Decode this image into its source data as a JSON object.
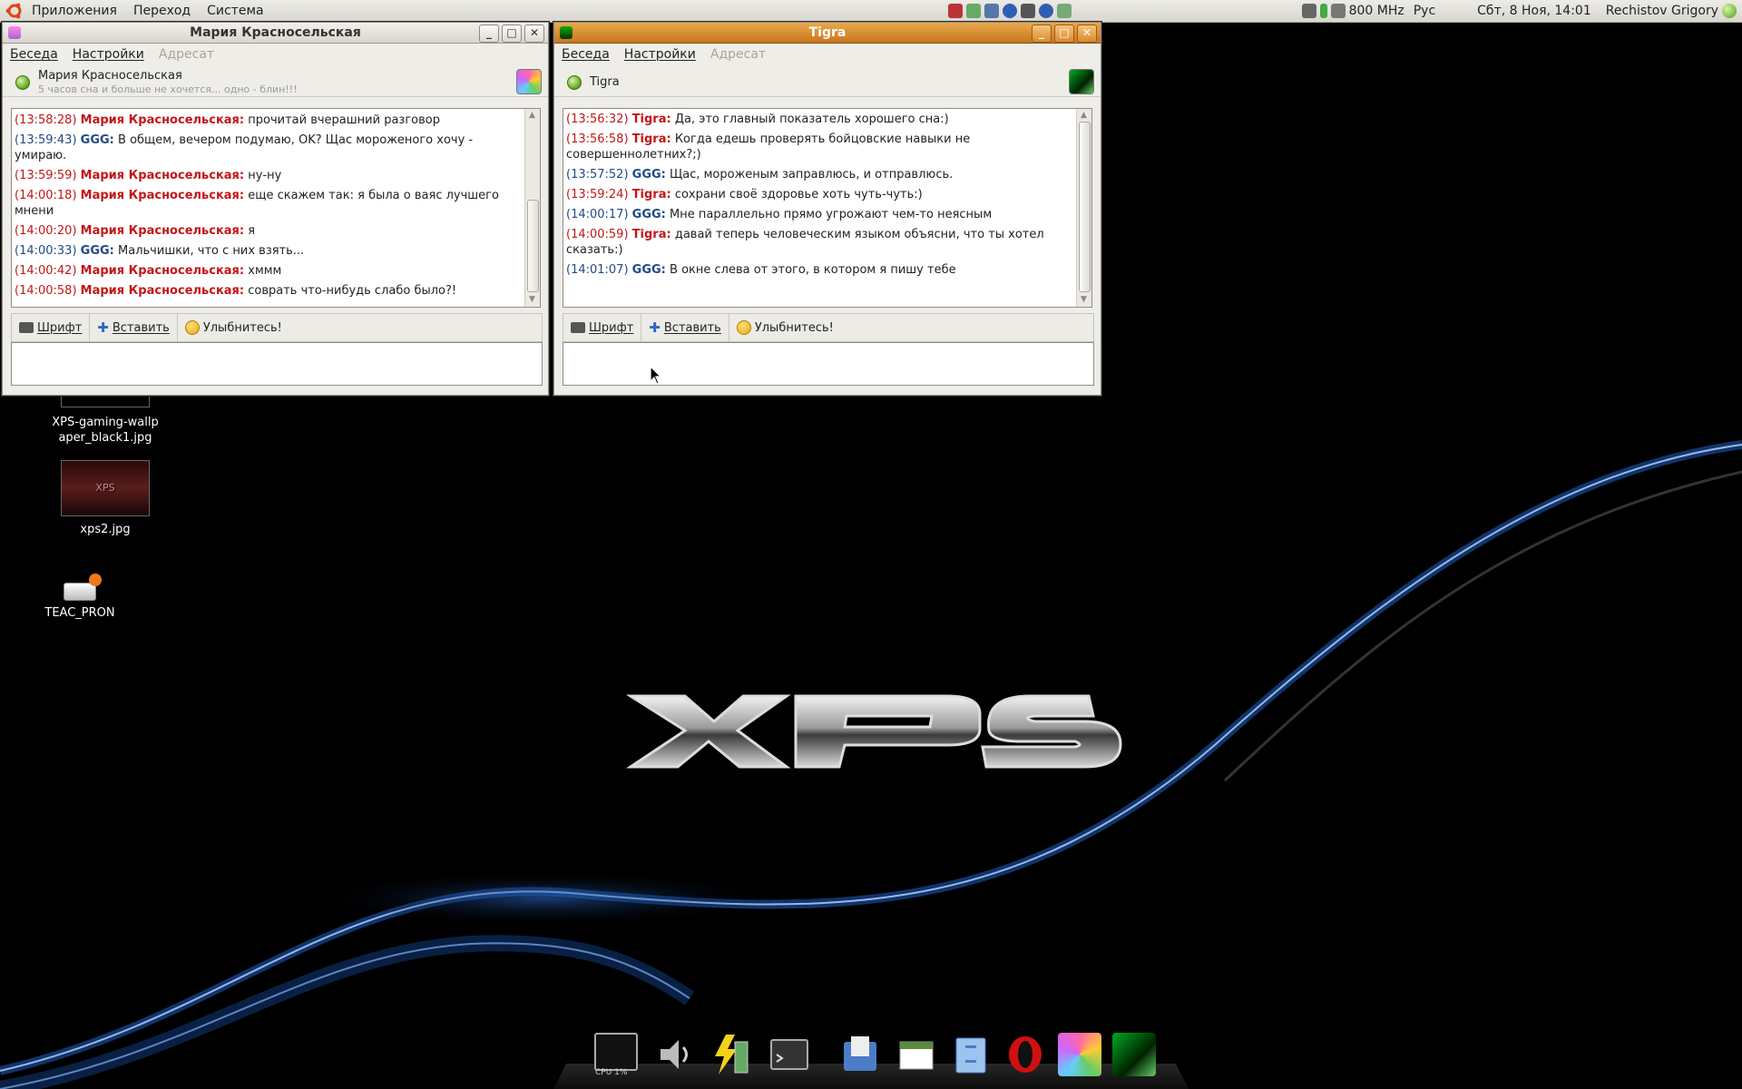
{
  "top_panel": {
    "menus": [
      "Приложения",
      "Переход",
      "Система"
    ],
    "cpu_freq": "800 MHz",
    "keyboard_layout": "Рус",
    "clock": "Сбт, 8 Ноя, 14:01",
    "user": "Rechistov Grigory"
  },
  "windows": {
    "left": {
      "title": "Мария Красносельская",
      "menu": [
        "Беседа",
        "Настройки",
        "Адресат"
      ],
      "contact_name": "Мария Красносельская",
      "contact_status": "5 часов сна и больше не хочется... одно - блин!!!",
      "messages": [
        {
          "time": "(13:58:28)",
          "nick": "Мария Красносельская:",
          "text": "прочитай вчерашний разговор",
          "who": "them"
        },
        {
          "time": "(13:59:43)",
          "nick": "GGG:",
          "text": "В общем, вечером подумаю, OK? Щас мороженого хочу - умираю.",
          "who": "me"
        },
        {
          "time": "(13:59:59)",
          "nick": "Мария Красносельская:",
          "text": "ну-ну",
          "who": "them"
        },
        {
          "time": "(14:00:18)",
          "nick": "Мария Красносельская:",
          "text": "еще скажем так: я была о ваяс лучшего мнени",
          "who": "them"
        },
        {
          "time": "(14:00:20)",
          "nick": "Мария Красносельская:",
          "text": "я",
          "who": "them"
        },
        {
          "time": "(14:00:33)",
          "nick": "GGG:",
          "text": "Мальчишки, что с них взять...",
          "who": "me"
        },
        {
          "time": "(14:00:42)",
          "nick": "Мария Красносельская:",
          "text": "хммм",
          "who": "them"
        },
        {
          "time": "(14:00:58)",
          "nick": "Мария Красносельская:",
          "text": "соврать что-нибудь слабо было?!",
          "who": "them"
        }
      ],
      "toolbar": {
        "font": "Шрифт",
        "insert": "Вставить",
        "smile": "Улыбнитесь!"
      }
    },
    "right": {
      "title": "Tigra",
      "menu": [
        "Беседа",
        "Настройки",
        "Адресат"
      ],
      "contact_name": "Tigra",
      "messages": [
        {
          "time": "(13:56:32)",
          "nick": "Tigra:",
          "text": "Да, это главный показатель хорошего сна:)",
          "who": "them"
        },
        {
          "time": "(13:56:58)",
          "nick": "Tigra:",
          "text": "Когда едешь проверять бойцовские навыки не совершеннолетних?;)",
          "who": "them"
        },
        {
          "time": "(13:57:52)",
          "nick": "GGG:",
          "text": "Щас, мороженым заправлюсь, и отправлюсь.",
          "who": "me"
        },
        {
          "time": "(13:59:24)",
          "nick": "Tigra:",
          "text": "сохрани своё здоровье хоть чуть-чуть:)",
          "who": "them"
        },
        {
          "time": "(14:00:17)",
          "nick": "GGG:",
          "text": "Мне параллельно прямо угрожают чем-то неясным",
          "who": "me"
        },
        {
          "time": "(14:00:59)",
          "nick": "Tigra:",
          "text": "давай теперь человеческим языком объясни, что ты хотел сказать:)",
          "who": "them"
        },
        {
          "time": "(14:01:07)",
          "nick": "GGG:",
          "text": "В окне слева  от этого, в котором я пишу тебе",
          "who": "me"
        }
      ],
      "toolbar": {
        "font": "Шрифт",
        "insert": "Вставить",
        "smile": "Улыбнитесь!"
      }
    }
  },
  "desktop_icons": {
    "wallpaper_file": "XPS-gaming-wallpaper_black1.jpg",
    "xps2": "xps2.jpg",
    "drive": "TEAC_PRON"
  },
  "wallpaper_logo": "XPS",
  "dock": {
    "cpu_label": "CPU 1%"
  },
  "colors": {
    "them": "#c41616",
    "me": "#204a87",
    "active_title": "#d9892f"
  }
}
